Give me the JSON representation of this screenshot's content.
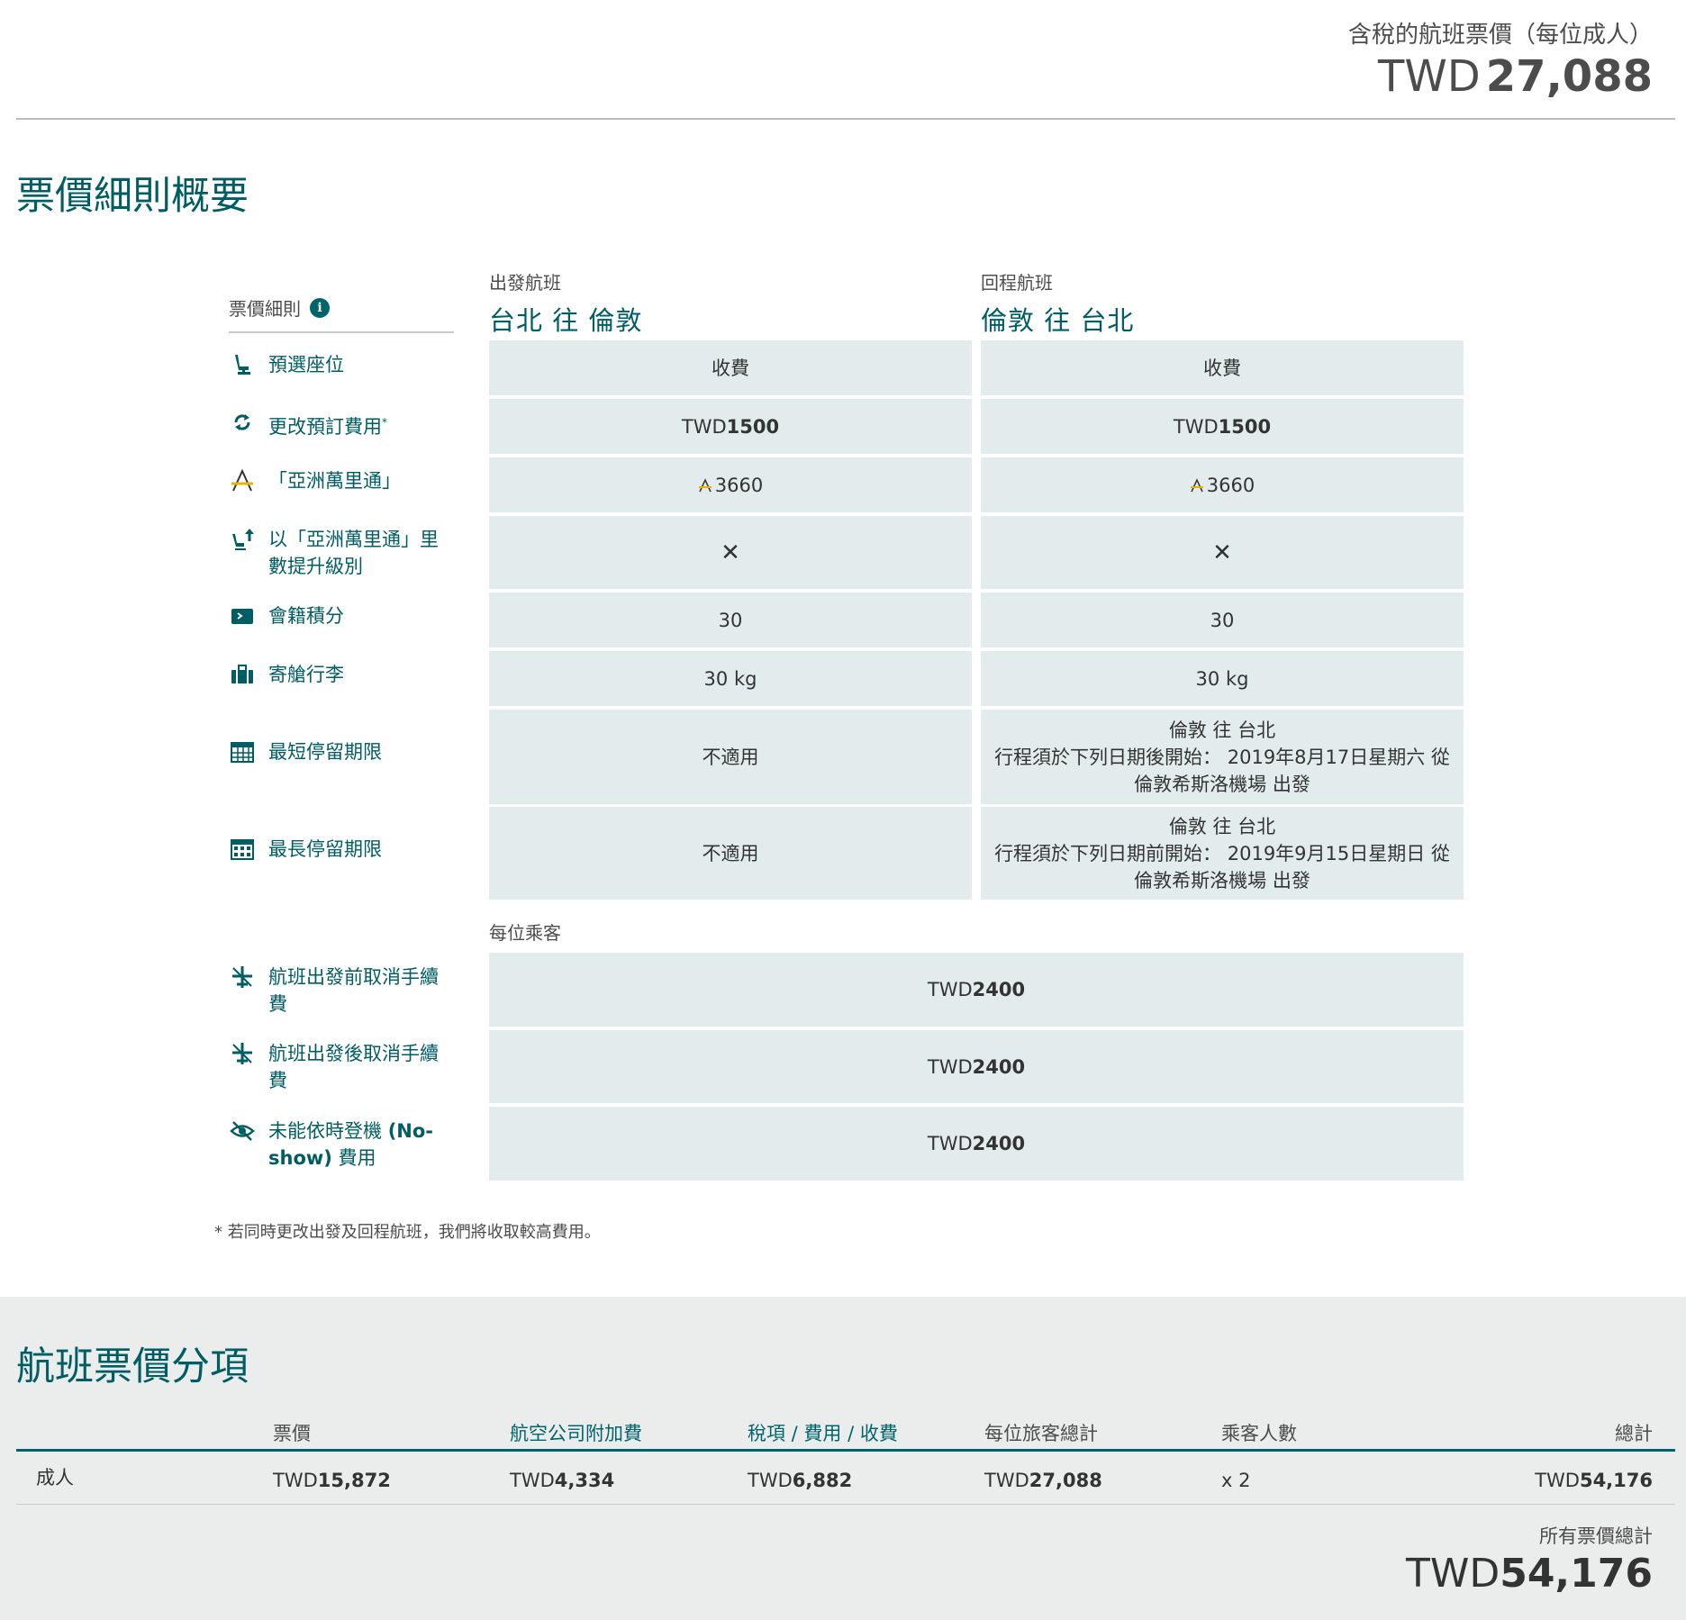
{
  "header": {
    "price_label": "含稅的航班票價（每位成人）",
    "currency": "TWD",
    "price_amount": "27,088"
  },
  "summary": {
    "title": "票價細則概要",
    "rules_label": "票價細則",
    "outbound": {
      "small": "出發航班",
      "route": "台北 往 倫敦"
    },
    "inbound": {
      "small": "回程航班",
      "route": "倫敦 往 台北"
    },
    "rows": {
      "seat": {
        "label": "預選座位",
        "out": "收費",
        "in": "收費"
      },
      "change": {
        "label": "更改預訂費用",
        "out_cur": "TWD",
        "out_val": "1500",
        "in_cur": "TWD",
        "in_val": "1500"
      },
      "asiamiles": {
        "label": "「亞洲萬里通」",
        "out": "3660",
        "in": "3660"
      },
      "upgrade": {
        "label": "以「亞洲萬里通」里數提升級別",
        "out": "✕",
        "in": "✕"
      },
      "club": {
        "label": "會籍積分",
        "out": "30",
        "in": "30"
      },
      "baggage": {
        "label": "寄艙行李",
        "out": "30 kg",
        "in": "30 kg"
      },
      "min_stay": {
        "label": "最短停留期限",
        "out": "不適用",
        "in_line1": "倫敦 往 台北",
        "in_line2": "行程須於下列日期後開始： 2019年8月17日星期六 從",
        "in_line3": "倫敦希斯洛機場 出發"
      },
      "max_stay": {
        "label": "最長停留期限",
        "out": "不適用",
        "in_line1": "倫敦 往 台北",
        "in_line2": "行程須於下列日期前開始： 2019年9月15日星期日 從",
        "in_line3": "倫敦希斯洛機場 出發"
      }
    },
    "per_passenger": "每位乘客",
    "passenger_rows": {
      "cancel_before": {
        "label": "航班出發前取消手續費",
        "cur": "TWD",
        "val": "2400"
      },
      "cancel_after": {
        "label": "航班出發後取消手續費",
        "cur": "TWD",
        "val": "2400"
      },
      "noshow": {
        "label_a": "未能依時登機 ",
        "label_b": "(No-show)",
        "label_c": " 費用",
        "cur": "TWD",
        "val": "2400"
      }
    },
    "footnote": "* 若同時更改出發及回程航班，我們將收取較高費用。"
  },
  "breakdown": {
    "title": "航班票價分項",
    "headers": {
      "fare": "票價",
      "surcharge": "航空公司附加費",
      "taxes": "稅項 / 費用 / 收費",
      "per_pax": "每位旅客總計",
      "pax_count": "乘客人數",
      "total": "總計"
    },
    "row": {
      "type": "成人",
      "fare_cur": "TWD",
      "fare": "15,872",
      "surcharge_cur": "TWD",
      "surcharge": "4,334",
      "taxes_cur": "TWD",
      "taxes": "6,882",
      "per_pax_cur": "TWD",
      "per_pax": "27,088",
      "pax_count": "x 2",
      "total_cur": "TWD",
      "total": "54,176"
    },
    "grand_total_label": "所有票價總計",
    "grand_total_cur": "TWD",
    "grand_total": "54,176"
  },
  "colors": {
    "brand": "#005d63",
    "cell_bg": "#e3ecec",
    "breakdown_bg": "#ebedec",
    "asia_yellow": "#e8b400"
  },
  "icons": [
    "seat-icon",
    "refresh-icon",
    "asia-miles-icon",
    "upgrade-seat-icon",
    "club-card-icon",
    "baggage-icon",
    "calendar-icon",
    "calendar-grid-icon",
    "cancel-flight-icon",
    "cancel-flight-icon",
    "no-show-icon",
    "info-icon"
  ]
}
